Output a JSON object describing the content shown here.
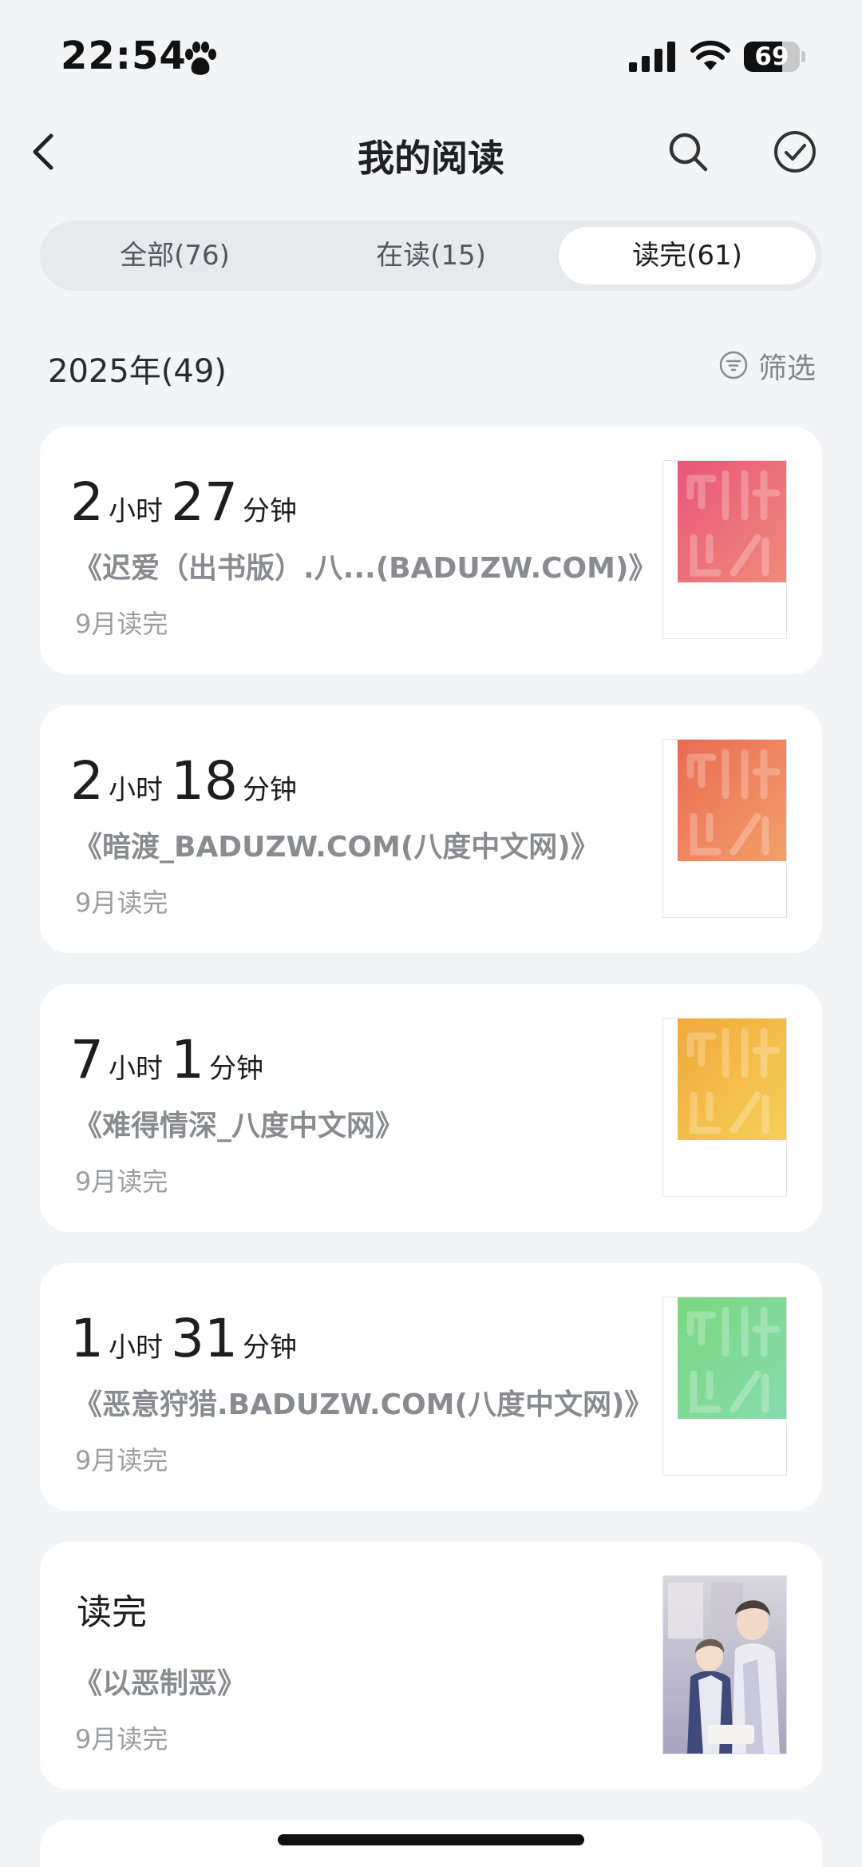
{
  "status_bar": {
    "time": "22:54",
    "battery": "69",
    "battery_level": 0.69
  },
  "nav": {
    "title": "我的阅读"
  },
  "tabs": [
    {
      "label": "全部(76)",
      "active": false
    },
    {
      "label": "在读(15)",
      "active": false
    },
    {
      "label": "读完(61)",
      "active": true
    }
  ],
  "section": {
    "year_label": "2025年(49)",
    "filter_label": "筛选"
  },
  "units": {
    "hour": "小时",
    "minute": "分钟"
  },
  "books": [
    {
      "hours": "2",
      "minutes": "27",
      "title": "《迟爱（出书版）.八...(BADUZW.COM)》",
      "date": "9月读完",
      "cover": "placeholder-pink"
    },
    {
      "hours": "2",
      "minutes": "18",
      "title": "《暗渡_BADUZW.COM(八度中文网)》",
      "date": "9月读完",
      "cover": "placeholder-orange"
    },
    {
      "hours": "7",
      "minutes": "1",
      "title": "《难得情深_八度中文网》",
      "date": "9月读完",
      "cover": "placeholder-yellow"
    },
    {
      "hours": "1",
      "minutes": "31",
      "title": "《恶意狩猎.BADUZW.COM(八度中文网)》",
      "date": "9月读完",
      "cover": "placeholder-green"
    },
    {
      "status": "读完",
      "title": "《以恶制恶》",
      "date": "9月读完",
      "cover": "illustrated-photo"
    }
  ],
  "colors": {
    "background": "#f3f4f6",
    "card": "#ffffff",
    "cover_pink": [
      "#e9557a",
      "#ef8c79"
    ],
    "cover_orange": [
      "#ea6a52",
      "#f2a16a"
    ],
    "cover_yellow": [
      "#f1a93a",
      "#f6cf5a"
    ],
    "cover_green": [
      "#7bd67f",
      "#86dcae"
    ]
  }
}
